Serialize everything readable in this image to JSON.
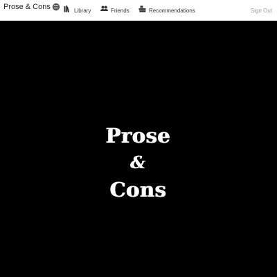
{
  "navbar": {
    "brand": {
      "label": "Prose & Cons",
      "logo_icon": "brain-icon"
    },
    "items": [
      {
        "label": "Library",
        "icon": "books-icon"
      },
      {
        "label": "Friends",
        "icon": "people-icon"
      },
      {
        "label": "Recommendations",
        "icon": "books-stack-icon"
      }
    ],
    "sign_out_label": "Sign Out"
  },
  "hero": {
    "line1": "Prose",
    "line2": "&",
    "line3": "Cons"
  },
  "colors": {
    "navbar_bg": "#ffffff",
    "hero_bg": "#000000",
    "hero_text": "#ffffff",
    "muted_text": "#9a9a9a"
  }
}
